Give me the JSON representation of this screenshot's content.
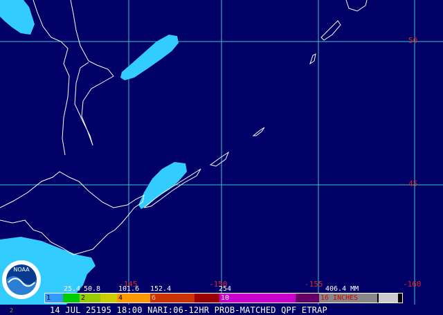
{
  "map": {
    "ocean_color": "#000066",
    "grid_color": "#33cccc",
    "coast_color": "#ffffff",
    "precip_color": "#33ccff",
    "label_color": "#e0242c",
    "lat_labels": [
      "50",
      "45"
    ],
    "lon_labels": [
      "-145",
      "-150",
      "-155",
      "-160"
    ]
  },
  "legend": {
    "mm_values": [
      "25.4",
      "50.8",
      "101.6",
      "152.4",
      "254",
      "406.4 MM"
    ],
    "segments": [
      {
        "color": "#3399ff",
        "label": "1"
      },
      {
        "color": "#00cc00",
        "label": ""
      },
      {
        "color": "#99cc00",
        "label": "2"
      },
      {
        "color": "#cccc00",
        "label": ""
      },
      {
        "color": "#ff9900",
        "label": "4"
      },
      {
        "color": "#cc3300",
        "label": "6"
      },
      {
        "color": "#990000",
        "label": ""
      },
      {
        "color": "#cc00cc",
        "label": "10"
      },
      {
        "color": "#660066",
        "label": ""
      },
      {
        "color": "#888888",
        "label": "16 INCHES"
      },
      {
        "color": "#cccccc",
        "label": ""
      }
    ]
  },
  "caption": "14 JUL 25195 18:00 NARI:06-12HR PROB-MATCHED QPF ETRAP",
  "logo": {
    "text": "NOAA",
    "outer_color": "#ffffff",
    "inner_color": "#0a3a8f",
    "bird_color": "#2a7fd4"
  },
  "corner_mark": "2"
}
